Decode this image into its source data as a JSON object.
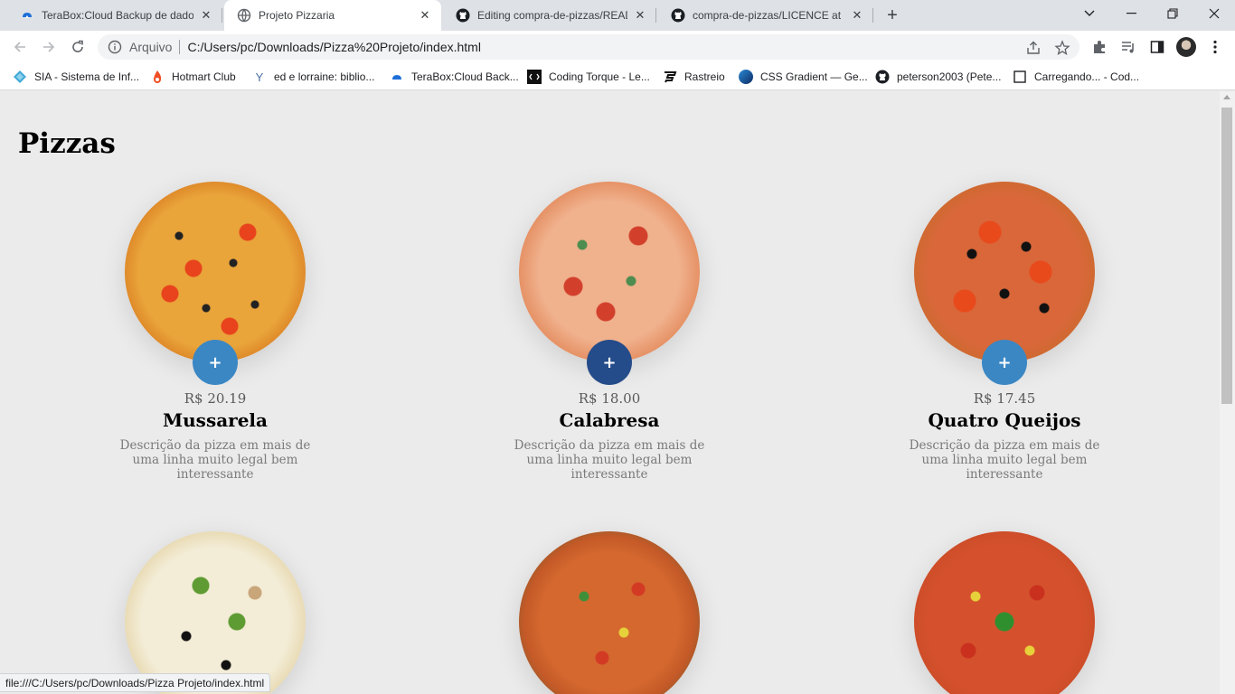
{
  "browser": {
    "tabs": [
      {
        "title": "TeraBox:Cloud Backup de dados",
        "icon": "terabox-icon",
        "active": false
      },
      {
        "title": "Projeto Pizzaria",
        "icon": "globe-icon",
        "active": true
      },
      {
        "title": "Editing compra-de-pizzas/READM",
        "icon": "github-icon",
        "active": false
      },
      {
        "title": "compra-de-pizzas/LICENCE at m",
        "icon": "github-icon",
        "active": false
      }
    ],
    "address": {
      "scheme_label": "Arquivo",
      "url": "C:/Users/pc/Downloads/Pizza%20Projeto/index.html"
    },
    "bookmarks": [
      {
        "label": "SIA - Sistema de Inf...",
        "icon": "sia-icon"
      },
      {
        "label": "Hotmart Club",
        "icon": "hotmart-icon"
      },
      {
        "label": "ed e lorraine: biblio...",
        "icon": "y-icon"
      },
      {
        "label": "TeraBox:Cloud Back...",
        "icon": "terabox-icon"
      },
      {
        "label": "Coding Torque - Le...",
        "icon": "codingtorque-icon"
      },
      {
        "label": "Rastreio",
        "icon": "rastreio-icon"
      },
      {
        "label": "CSS Gradient — Ge...",
        "icon": "cssgradient-icon"
      },
      {
        "label": "peterson2003 (Pete...",
        "icon": "github-icon"
      },
      {
        "label": "Carregando... - Cod...",
        "icon": "page-icon"
      }
    ],
    "status_url": "file:///C:/Users/pc/Downloads/Pizza Projeto/index.html"
  },
  "page": {
    "heading": "Pizzas",
    "add_label": "+",
    "pizzas": [
      {
        "name": "Mussarela",
        "price": "R$ 20.19",
        "description": "Descrição da pizza em mais de uma linha muito legal bem interessante"
      },
      {
        "name": "Calabresa",
        "price": "R$ 18.00",
        "description": "Descrição da pizza em mais de uma linha muito legal bem interessante"
      },
      {
        "name": "Quatro Queijos",
        "price": "R$ 17.45",
        "description": "Descrição da pizza em mais de uma linha muito legal bem interessante"
      },
      {
        "name": "",
        "price": "",
        "description": ""
      },
      {
        "name": "",
        "price": "",
        "description": ""
      },
      {
        "name": "",
        "price": "",
        "description": ""
      }
    ]
  },
  "colors": {
    "add_button": "#3a87c4",
    "add_button_hover": "#254c8a",
    "page_background": "#ebebeb"
  }
}
